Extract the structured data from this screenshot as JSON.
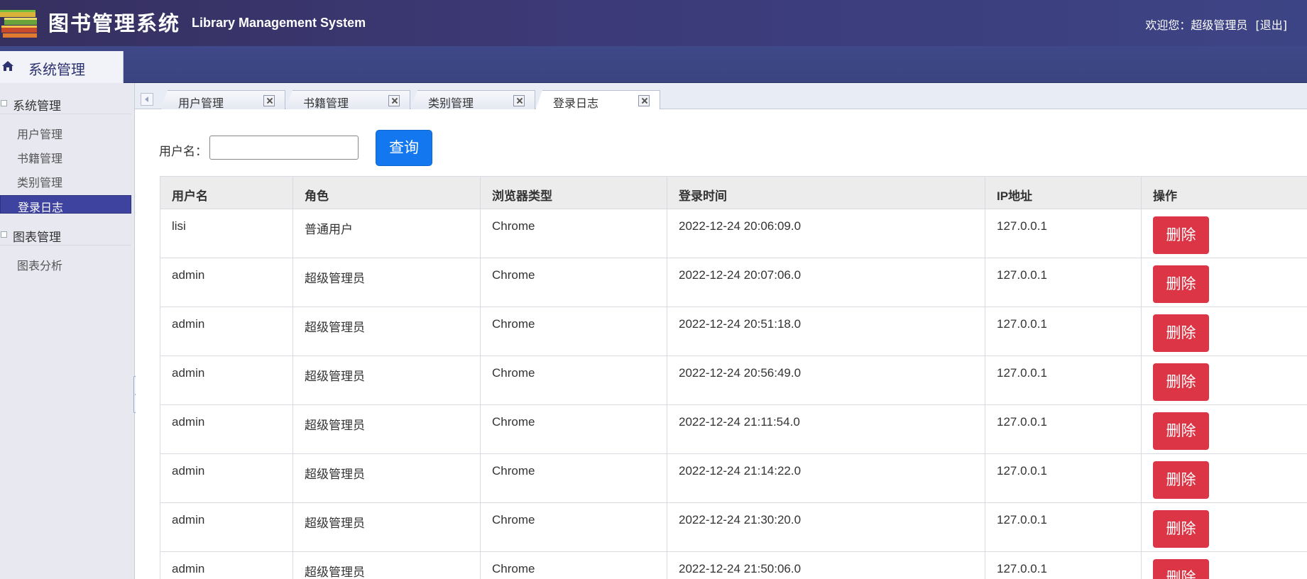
{
  "header": {
    "title": "图书管理系统",
    "subtitle": "Library Management System",
    "welcome_text": "欢迎您：超级管理员",
    "logout_label": "[退出]"
  },
  "panel": {
    "title": "系统管理"
  },
  "sidebar": {
    "groups": [
      {
        "title": "系统管理",
        "items": [
          "用户管理",
          "书籍管理",
          "类别管理",
          "登录日志"
        ]
      },
      {
        "title": "图表管理",
        "items": [
          "图表分析"
        ]
      }
    ],
    "active_item": "登录日志"
  },
  "tabs": [
    {
      "label": "用户管理",
      "active": false
    },
    {
      "label": "书籍管理",
      "active": false
    },
    {
      "label": "类别管理",
      "active": false
    },
    {
      "label": "登录日志",
      "active": true
    }
  ],
  "search": {
    "label": "用户名：",
    "value": "",
    "button_label": "查询"
  },
  "table": {
    "columns": [
      "用户名",
      "角色",
      "浏览器类型",
      "登录时间",
      "IP地址",
      "操作"
    ],
    "delete_label": "删除",
    "rows": [
      [
        "lisi",
        "普通用户",
        "Chrome",
        "2022-12-24 20:06:09.0",
        "127.0.0.1"
      ],
      [
        "admin",
        "超级管理员",
        "Chrome",
        "2022-12-24 20:07:06.0",
        "127.0.0.1"
      ],
      [
        "admin",
        "超级管理员",
        "Chrome",
        "2022-12-24 20:51:18.0",
        "127.0.0.1"
      ],
      [
        "admin",
        "超级管理员",
        "Chrome",
        "2022-12-24 20:56:49.0",
        "127.0.0.1"
      ],
      [
        "admin",
        "超级管理员",
        "Chrome",
        "2022-12-24 21:11:54.0",
        "127.0.0.1"
      ],
      [
        "admin",
        "超级管理员",
        "Chrome",
        "2022-12-24 21:14:22.0",
        "127.0.0.1"
      ],
      [
        "admin",
        "超级管理员",
        "Chrome",
        "2022-12-24 21:30:20.0",
        "127.0.0.1"
      ],
      [
        "admin",
        "超级管理员",
        "Chrome",
        "2022-12-24 21:50:06.0",
        "127.0.0.1"
      ]
    ]
  },
  "colors": {
    "header_bg": "#3c3a78",
    "active_nav": "#3f43a0",
    "query_button": "#1378ef",
    "delete_button": "#dc3545"
  }
}
